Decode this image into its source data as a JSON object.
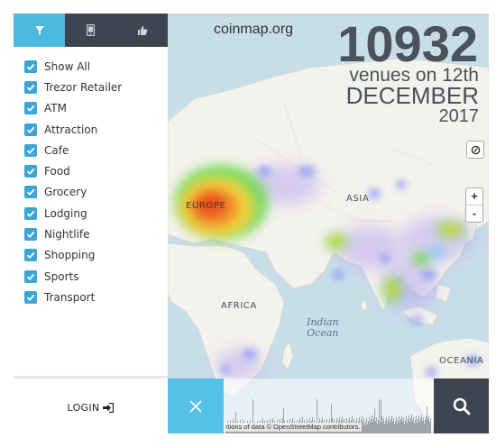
{
  "site": {
    "name": "coinmap.org"
  },
  "stats": {
    "count": "10932",
    "line1": "venues on 12th",
    "line2": "DECEMBER",
    "line3": "2017"
  },
  "sidebar": {
    "tabs": [
      {
        "icon": "filter-icon",
        "active": true
      },
      {
        "icon": "mobile-icon",
        "active": false
      },
      {
        "icon": "thumbs-up-icon",
        "active": false
      }
    ],
    "filters": [
      {
        "label": "Show All",
        "checked": true
      },
      {
        "label": "Trezor Retailer",
        "checked": true
      },
      {
        "label": "ATM",
        "checked": true
      },
      {
        "label": "Attraction",
        "checked": true
      },
      {
        "label": "Cafe",
        "checked": true
      },
      {
        "label": "Food",
        "checked": true
      },
      {
        "label": "Grocery",
        "checked": true
      },
      {
        "label": "Lodging",
        "checked": true
      },
      {
        "label": "Nightlife",
        "checked": true
      },
      {
        "label": "Shopping",
        "checked": true
      },
      {
        "label": "Sports",
        "checked": true
      },
      {
        "label": "Transport",
        "checked": true
      }
    ],
    "login_label": "LOGIN"
  },
  "map": {
    "labels": {
      "europe": "EUROPE",
      "asia": "ASIA",
      "africa": "AFRICA",
      "oceania": "OCEANIA"
    },
    "ocean_line1": "Indian",
    "ocean_line2": "Ocean",
    "zoom_in": "+",
    "zoom_out": "-",
    "attribution": "rtions of data © OpenStreetMap contributors."
  },
  "colors": {
    "accent": "#4db8df",
    "dark": "#3d4550",
    "checkbox": "#3aa6d8",
    "heat_hot": "#e8501a",
    "heat_mid": "#6fd64f"
  },
  "icons": {
    "close": "close-icon",
    "search": "search-icon",
    "locate": "locate-icon",
    "login": "sign-in-icon"
  }
}
